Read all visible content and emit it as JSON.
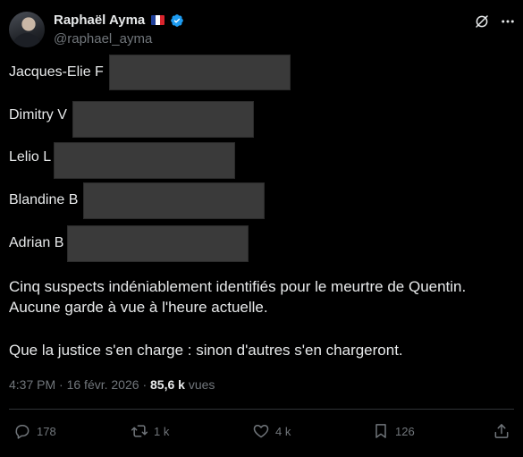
{
  "author": {
    "display_name": "Raphaël Ayma",
    "handle": "@raphael_ayma",
    "flag_colors": [
      "#1f3f9a",
      "#ffffff",
      "#d9252d"
    ],
    "verified_color": "#1d9bf0"
  },
  "header_icons": [
    "grok-icon",
    "more-icon"
  ],
  "names": [
    "Jacques-Elie F",
    "Dimitry V",
    "Lelio L",
    "Blandine B",
    "Adrian B"
  ],
  "paragraphs": [
    "Cinq suspects indéniablement identifiés pour le meurtre de Quentin.",
    "Aucune garde à vue à l'heure actuelle.",
    "Que la justice s'en charge : sinon d'autres s'en chargeront."
  ],
  "meta": {
    "time": "4:37 PM",
    "separator": "·",
    "date": "16 févr. 2026",
    "views_count": "85,6 k",
    "views_label": "vues"
  },
  "actions": {
    "replies": "178",
    "reposts": "1 k",
    "likes": "4 k",
    "bookmarks": "126"
  },
  "colors": {
    "background": "#000000",
    "text": "#e7e9ea",
    "muted": "#71767b",
    "redaction": "#3a3a3a"
  }
}
